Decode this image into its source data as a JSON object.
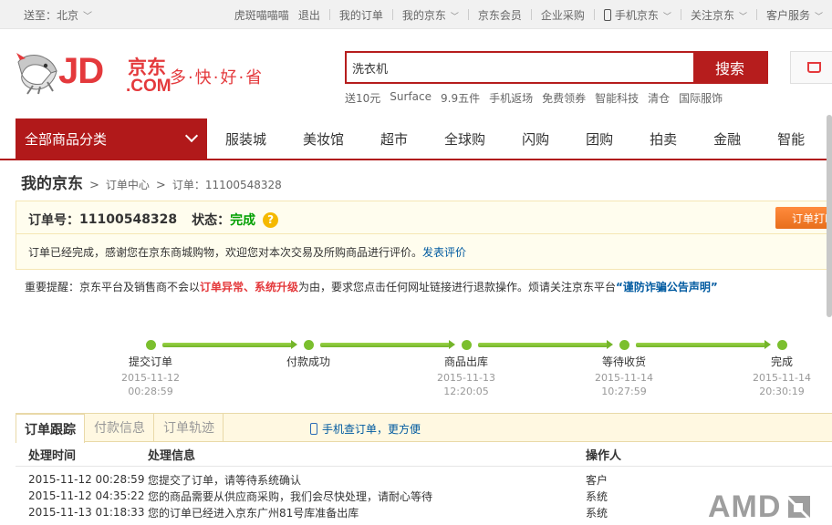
{
  "topbar": {
    "location": "送至：北京",
    "links": [
      {
        "label": "虎斑喵喵喵",
        "chevron": false
      },
      {
        "label": "退出",
        "chevron": false
      },
      {
        "label": "我的订单",
        "chevron": false
      },
      {
        "label": "我的京东",
        "chevron": true
      },
      {
        "label": "京东会员",
        "chevron": false
      },
      {
        "label": "企业采购",
        "chevron": false
      },
      {
        "label": "手机京东",
        "chevron": true
      },
      {
        "label": "关注京东",
        "chevron": true
      },
      {
        "label": "客户服务",
        "chevron": true
      }
    ]
  },
  "header": {
    "logo_jd": "JD",
    "logo_cn": "京东",
    "logo_com": ".COM",
    "slogan": "多·快·好·省",
    "search_value": "洗衣机",
    "search_button": "搜索",
    "hotwords": [
      "送10元",
      "Surface",
      "9.9五件",
      "手机返场",
      "免费领券",
      "智能科技",
      "清仓",
      "国际服饰"
    ]
  },
  "nav": {
    "all_categories": "全部商品分类",
    "items": [
      "服装城",
      "美妆馆",
      "超市",
      "全球购",
      "闪购",
      "团购",
      "拍卖",
      "金融",
      "智能"
    ]
  },
  "breadcrumb": {
    "home": "我的京东",
    "center": "订单中心",
    "order": "订单：11100548328"
  },
  "order": {
    "number_label": "订单号：",
    "number": "11100548328",
    "status_label": "状态：",
    "status": "完成",
    "message": "订单已经完成，感谢您在京东商城购物，欢迎您对本次交易及所购商品进行评价。",
    "review_link": "发表评价",
    "print_button": "订单打印"
  },
  "notice": {
    "prefix": "重要提醒：京东平台及销售商不会以",
    "red": "订单异常、系统升级",
    "middle": "为由，要求您点击任何网址链接进行退款操作。烦请关注京东平台",
    "link": "“谨防诈骗公告声明”"
  },
  "progress": {
    "steps": [
      {
        "title": "提交订单",
        "date": "2015-11-12",
        "time": "00:28:59"
      },
      {
        "title": "付款成功",
        "date": "",
        "time": ""
      },
      {
        "title": "商品出库",
        "date": "2015-11-13",
        "time": "12:20:05"
      },
      {
        "title": "等待收货",
        "date": "2015-11-14",
        "time": "10:27:59"
      },
      {
        "title": "完成",
        "date": "2015-11-14",
        "time": "20:30:19"
      }
    ]
  },
  "tabs": {
    "items": [
      "订单跟踪",
      "付款信息",
      "订单轨迹"
    ],
    "mobile_link": "手机查订单，更方便"
  },
  "log": {
    "headers": [
      "处理时间",
      "处理信息",
      "操作人"
    ],
    "rows": [
      {
        "time": "2015-11-12 00:28:59",
        "info": "您提交了订单，请等待系统确认",
        "operator": "客户"
      },
      {
        "time": "2015-11-12 04:35:22",
        "info": "您的商品需要从供应商采购，我们会尽快处理，请耐心等待",
        "operator": "系统"
      },
      {
        "time": "2015-11-13 01:18:33",
        "info": "您的订单已经进入京东广州81号库准备出库",
        "operator": "系统"
      }
    ]
  },
  "watermark": "AMD"
}
